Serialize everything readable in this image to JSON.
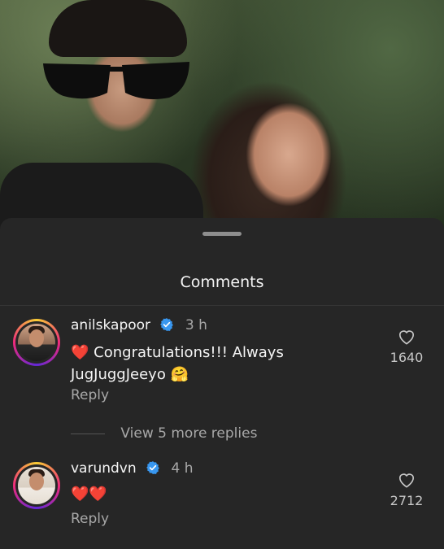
{
  "sheet": {
    "title": "Comments"
  },
  "comments": [
    {
      "username": "anilskapoor",
      "verified": true,
      "time": "3 h",
      "text_emoji": "❤️",
      "text_line1": "Congratulations!!! Always",
      "text_line2": "JugJuggJeeyo",
      "text_trail_emoji": "🤗",
      "reply_label": "Reply",
      "like_count": "1640"
    },
    {
      "username": "varundvn",
      "verified": true,
      "time": "4 h",
      "text": "❤️❤️",
      "reply_label": "Reply",
      "like_count": "2712"
    }
  ],
  "view_more_replies": "View 5 more replies",
  "icons": {
    "verified": "verified-badge-icon",
    "like": "heart-outline-icon"
  },
  "colors": {
    "background": "#262626",
    "text_primary": "#f5f5f5",
    "text_secondary": "#a8a8a8",
    "verified_blue": "#3897f0"
  }
}
